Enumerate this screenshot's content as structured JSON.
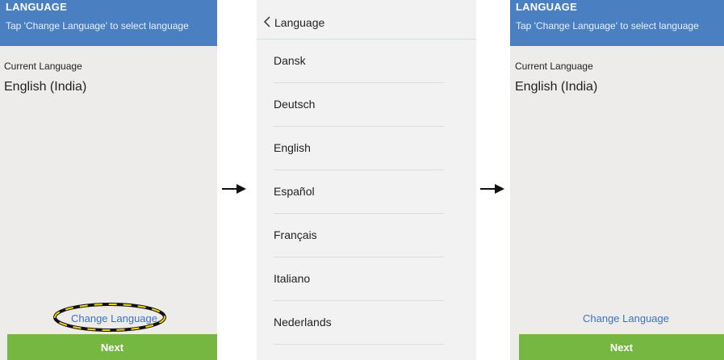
{
  "screen_left": {
    "header_title": "LANGUAGE",
    "header_subtitle": "Tap 'Change Language' to select language",
    "current_label": "Current Language",
    "current_value": "English (India)",
    "change_link": "Change Language",
    "next_button": "Next"
  },
  "screen_middle": {
    "title": "Language",
    "languages": [
      "Dansk",
      "Deutsch",
      "English",
      "Español",
      "Français",
      "Italiano",
      "Nederlands"
    ]
  },
  "screen_right": {
    "header_title": "LANGUAGE",
    "header_subtitle": "Tap 'Change Language' to select language",
    "current_label": "Current Language",
    "current_value": "English (India)",
    "change_link": "Change Language",
    "next_button": "Next"
  },
  "colors": {
    "header_blue": "#4a7fc2",
    "next_green": "#76b741",
    "link_blue": "#3b73c0",
    "highlight_yellow": "#f2d600"
  },
  "icons": [
    "back-chevron-icon",
    "right-arrow-icon"
  ]
}
